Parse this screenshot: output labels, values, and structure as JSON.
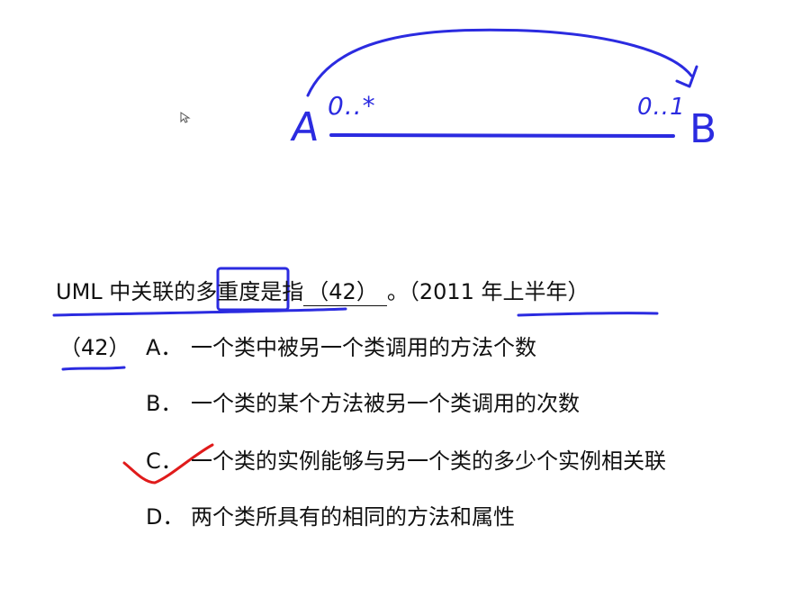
{
  "annotation": {
    "ink_color": "#2b2be0",
    "check_color": "#e01b1b",
    "class_a": "A",
    "class_b": "B",
    "multiplicity_a": "0..*",
    "multiplicity_b": "0..1"
  },
  "question": {
    "stem": "UML 中关联的多重度是指",
    "blank": "（42）",
    "tail": "。（2011 年上半年）"
  },
  "options": {
    "number": "（42）",
    "a": {
      "letter": "A．",
      "text": "一个类中被另一个类调用的方法个数"
    },
    "b": {
      "letter": "B．",
      "text": "一个类的某个方法被另一个类调用的次数"
    },
    "c": {
      "letter": "C．",
      "text": "一个类的实例能够与另一个类的多少个实例相关联"
    },
    "d": {
      "letter": "D．",
      "text": "两个类所具有的相同的方法和属性"
    }
  }
}
